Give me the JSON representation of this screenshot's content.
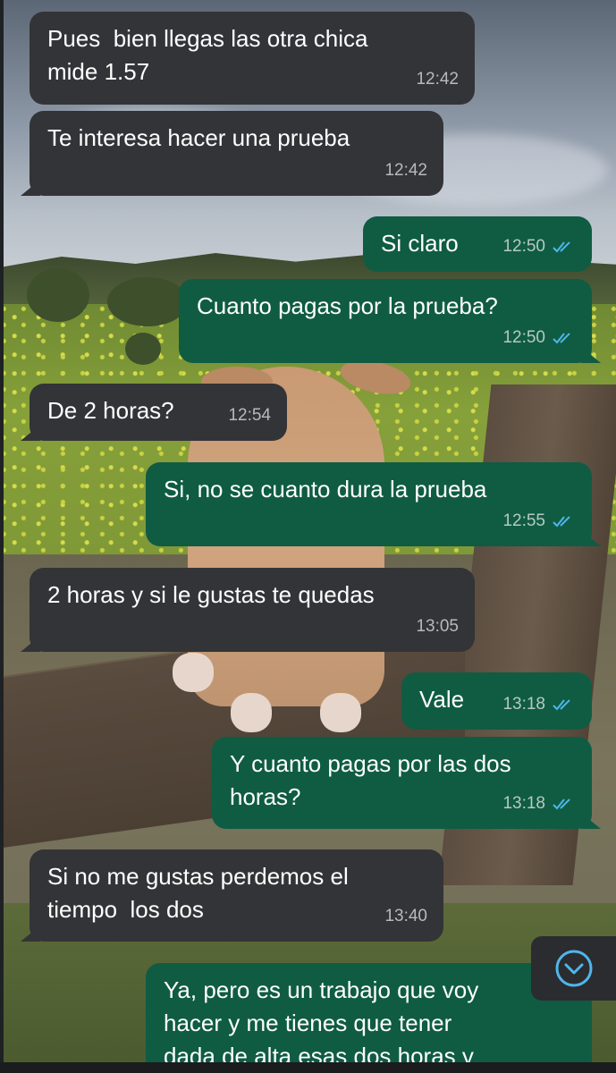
{
  "colors": {
    "incoming_bubble": "#333437",
    "outgoing_bubble": "#0f5c43",
    "read_ticks": "#4fb6ec"
  },
  "background": {
    "description_icon": "photo-wallpaper-dog-on-bench"
  },
  "messages": [
    {
      "direction": "in",
      "text": "Pues  bien llegas las otra chica\nmide 1.57",
      "time": "12:42"
    },
    {
      "direction": "in",
      "text": "Te interesa hacer una prueba",
      "time": "12:42"
    },
    {
      "direction": "out",
      "text": "Si claro",
      "time": "12:50",
      "status": "read"
    },
    {
      "direction": "out",
      "text": "Cuanto pagas por la prueba?",
      "time": "12:50",
      "status": "read"
    },
    {
      "direction": "in",
      "text": "De 2 horas?",
      "time": "12:54"
    },
    {
      "direction": "out",
      "text": "Si, no se cuanto dura la prueba",
      "time": "12:55",
      "status": "read"
    },
    {
      "direction": "in",
      "text": "2 horas y si le gustas te quedas",
      "time": "13:05"
    },
    {
      "direction": "out",
      "text": "Vale",
      "time": "13:18",
      "status": "read"
    },
    {
      "direction": "out",
      "text": "Y cuanto pagas por las dos\nhoras?",
      "time": "13:18",
      "status": "read"
    },
    {
      "direction": "in",
      "text": "Si no me gustas perdemos el\ntiempo  los dos",
      "time": "13:40"
    },
    {
      "direction": "out",
      "text": "Ya, pero es un trabajo que voy\nhacer y me tienes que tener\ndada de alta esas dos horas y",
      "time": "",
      "status": ""
    }
  ],
  "scroll_down_icon": "chevron-down-circle-icon"
}
